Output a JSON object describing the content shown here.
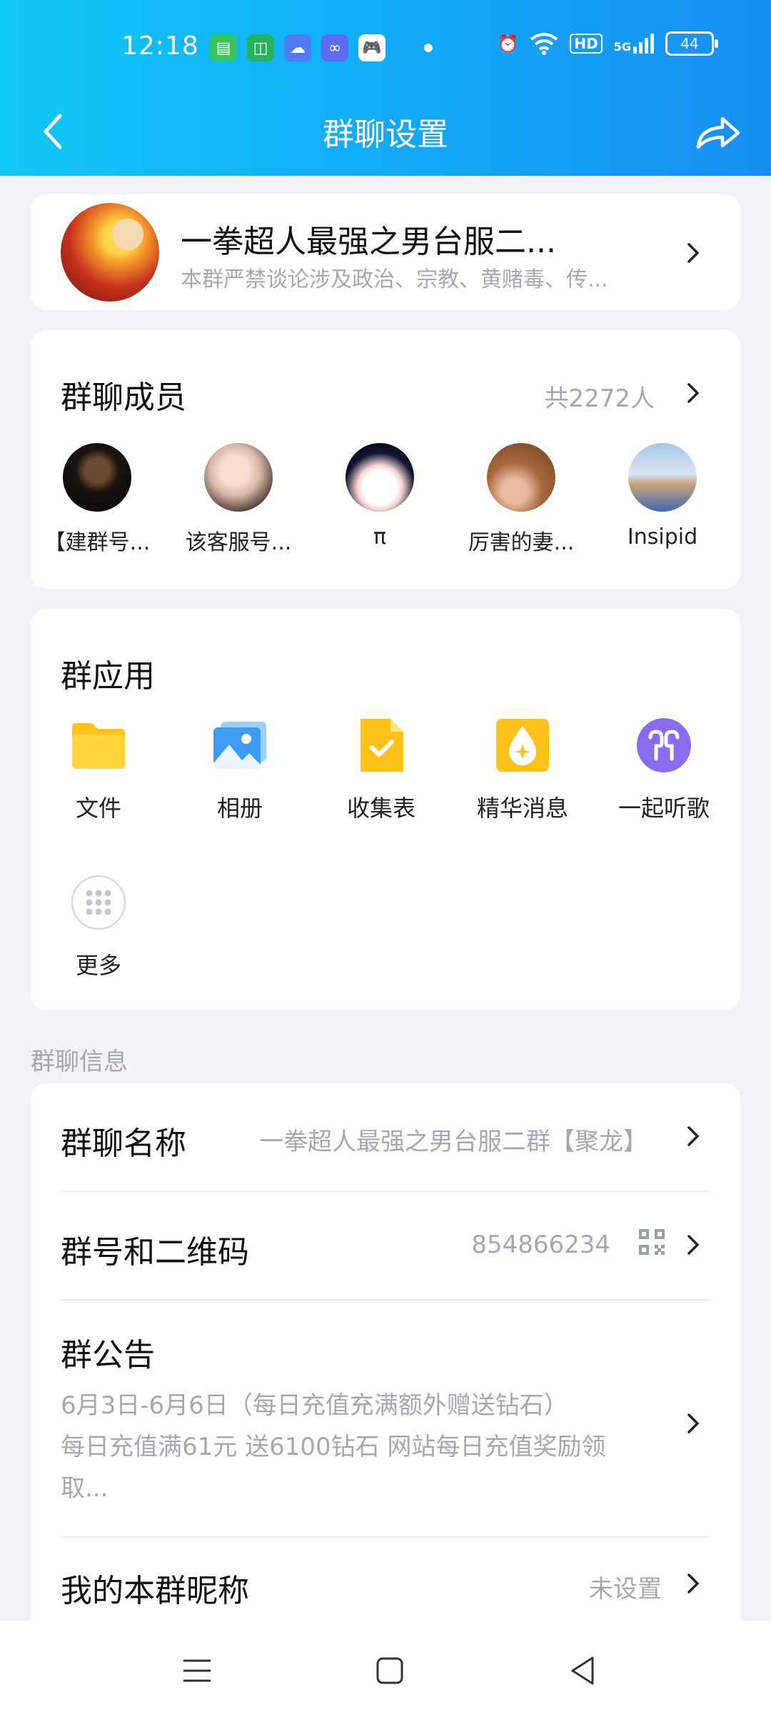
{
  "status_bar": {
    "time": "12:18",
    "hd": "HD",
    "signal": "5G",
    "battery": "44"
  },
  "header": {
    "title": "群聊设置"
  },
  "group": {
    "name": "一拳超人最强之男台服二...",
    "description": "本群严禁谈论涉及政治、宗教、黄赌毒、传..."
  },
  "members": {
    "title": "群聊成员",
    "count": "共2272人",
    "items": [
      {
        "name": "【建群号..."
      },
      {
        "name": "该客服号..."
      },
      {
        "name": "π"
      },
      {
        "name": "厉害的妻..."
      },
      {
        "name": "Insipid"
      }
    ]
  },
  "apps": {
    "title": "群应用",
    "items": [
      {
        "label": "文件",
        "icon": "folder-icon"
      },
      {
        "label": "相册",
        "icon": "photo-album-icon"
      },
      {
        "label": "收集表",
        "icon": "form-check-icon"
      },
      {
        "label": "精华消息",
        "icon": "essence-drop-icon"
      },
      {
        "label": "一起听歌",
        "icon": "earphones-icon"
      },
      {
        "label": "更多",
        "icon": "more-grid-icon"
      }
    ]
  },
  "info": {
    "section_label": "群聊信息",
    "name_label": "群聊名称",
    "name_value": "一拳超人最强之男台服二群【聚龙】",
    "number_label": "群号和二维码",
    "number_value": "854866234",
    "notice_label": "群公告",
    "notice_line1": "6月3日-6月6日（每日充值充满额外赠送钻石）",
    "notice_line2": "每日充值满61元 送6100钻石 网站每日充值奖励领",
    "notice_line3": "取...",
    "nickname_label": "我的本群昵称",
    "nickname_value": "未设置"
  },
  "colors": {
    "header_start": "#10c8f6",
    "header_end": "#168ff4",
    "folder": "#ffc21a",
    "album": "#3d9bf5",
    "form": "#ffc21a",
    "essence": "#ffc21a",
    "music": "#8a6cf0"
  }
}
